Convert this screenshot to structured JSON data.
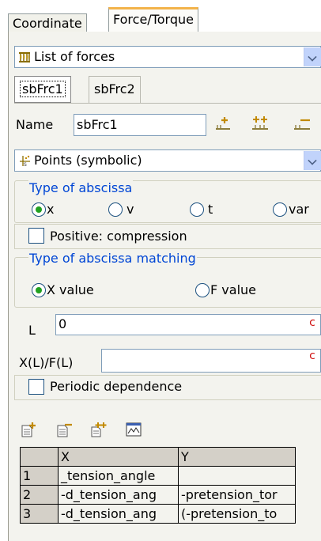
{
  "tabs": [
    {
      "label": "Coordinate",
      "active": false
    },
    {
      "label": "Force/Torque",
      "active": true
    }
  ],
  "force_list_combo": {
    "value": "List of forces",
    "icon": "force-list-icon"
  },
  "force_tabs": [
    {
      "label": "sbFrc1",
      "selected": true
    },
    {
      "label": "sbFrc2",
      "selected": false
    }
  ],
  "name_row": {
    "label": "Name",
    "value": "sbFrc1"
  },
  "points_combo": {
    "value": "Points (symbolic)",
    "icon": "points-symbolic-icon"
  },
  "abscissa_group": {
    "title": "Type of abscissa",
    "options": [
      {
        "label": "x",
        "checked": true
      },
      {
        "label": "v",
        "checked": false
      },
      {
        "label": "t",
        "checked": false
      },
      {
        "label": "var",
        "checked": false
      }
    ]
  },
  "positive_compression": {
    "label": "Positive: compression",
    "checked": false
  },
  "matching_group": {
    "title": "Type of abscissa matching",
    "options": [
      {
        "label": "X value",
        "checked": true
      },
      {
        "label": "F value",
        "checked": false
      }
    ]
  },
  "L_field": {
    "label": "L",
    "value": "0",
    "button": "c"
  },
  "XLFL_field": {
    "label": "X(L)/F(L)",
    "value": "",
    "button": "c"
  },
  "periodic": {
    "label": "Periodic dependence",
    "checked": false
  },
  "table": {
    "columns": [
      "",
      "X",
      "Y"
    ],
    "rows": [
      {
        "index": "1",
        "x": "_tension_angle",
        "y": ""
      },
      {
        "index": "2",
        "x": "-d_tension_ang",
        "y": "-pretension_tor"
      },
      {
        "index": "3",
        "x": "-d_tension_ang",
        "y": "(-pretension_to"
      }
    ]
  },
  "colors": {
    "accent_tab": "#f3b34a",
    "legend_blue": "#0046d5",
    "radio_on": "#21a121",
    "c_button": "#d01010"
  }
}
